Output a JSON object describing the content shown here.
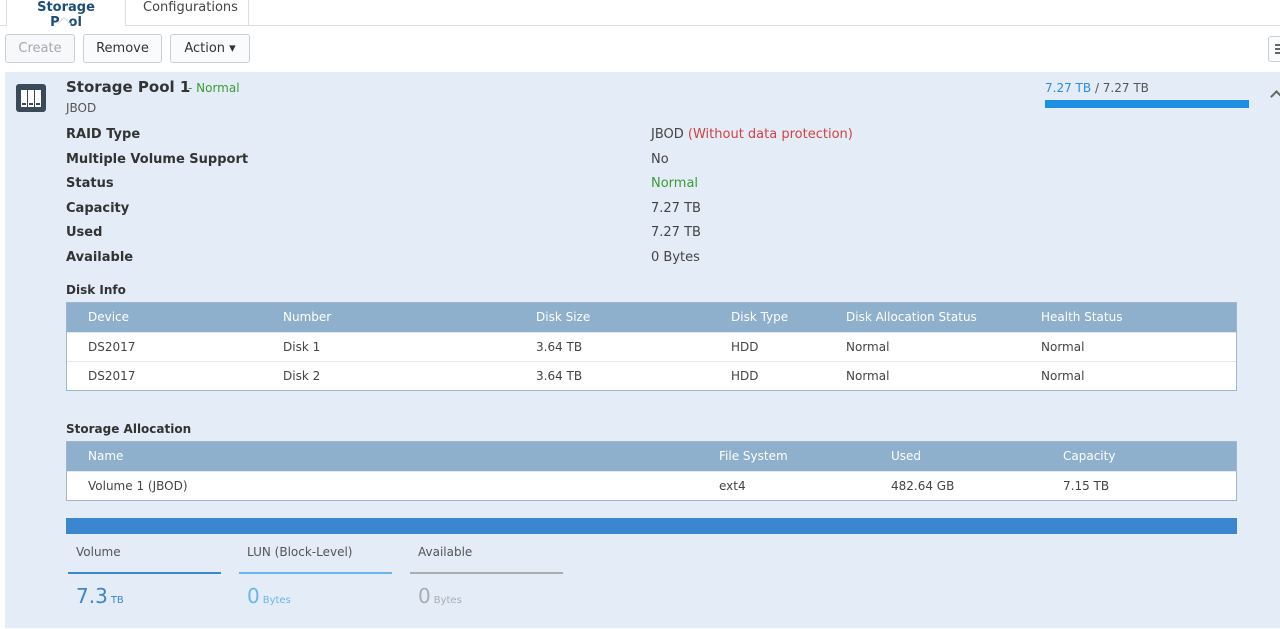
{
  "tabs": [
    {
      "label": "Storage Pool",
      "active": true
    },
    {
      "label": "Configurations",
      "active": false
    }
  ],
  "toolbar": {
    "create_label": "Create",
    "remove_label": "Remove",
    "action_label": "Action ▾"
  },
  "pool": {
    "title": "Storage Pool 1",
    "status": "- Normal",
    "subtitle": "JBOD",
    "usage_used": "7.27 TB",
    "usage_total": "/ 7.27 TB",
    "usage_fraction": 1.0,
    "properties": [
      {
        "label": "RAID Type",
        "value": "JBOD",
        "value_extra": "(Without data protection)"
      },
      {
        "label": "Multiple Volume Support",
        "value": "No"
      },
      {
        "label": "Status",
        "value": "Normal"
      },
      {
        "label": "Capacity",
        "value": "7.27 TB"
      },
      {
        "label": "Used",
        "value": "7.27 TB"
      },
      {
        "label": "Available",
        "value": "0 Bytes"
      }
    ]
  },
  "disk_info": {
    "title": "Disk Info",
    "columns": [
      "Device",
      "Number",
      "Disk Size",
      "Disk Type",
      "Disk Allocation Status",
      "Health Status"
    ],
    "rows": [
      [
        "DS2017",
        "Disk 1",
        "3.64 TB",
        "HDD",
        "Normal",
        "Normal"
      ],
      [
        "DS2017",
        "Disk 2",
        "3.64 TB",
        "HDD",
        "Normal",
        "Normal"
      ]
    ]
  },
  "storage_allocation": {
    "title": "Storage Allocation",
    "columns": [
      "Name",
      "File System",
      "Used",
      "Capacity"
    ],
    "rows": [
      [
        "Volume 1 (JBOD)",
        "ext4",
        "482.64 GB",
        "7.15 TB"
      ]
    ]
  },
  "allocation_legend": [
    {
      "label": "Volume",
      "value": "7.3",
      "unit": "TB",
      "color": "#3a86cf"
    },
    {
      "label": "LUN (Block-Level)",
      "value": "0",
      "unit": "Bytes",
      "color": "#6ab6ea"
    },
    {
      "label": "Available",
      "value": "0",
      "unit": "Bytes",
      "color": "#a8adb2"
    }
  ],
  "colors": {
    "accent": "#1e90e4",
    "status_ok": "#3b9b35",
    "warning": "#d04343",
    "panel_bg": "#e3ecf7",
    "table_header": "#8eb0cc"
  }
}
